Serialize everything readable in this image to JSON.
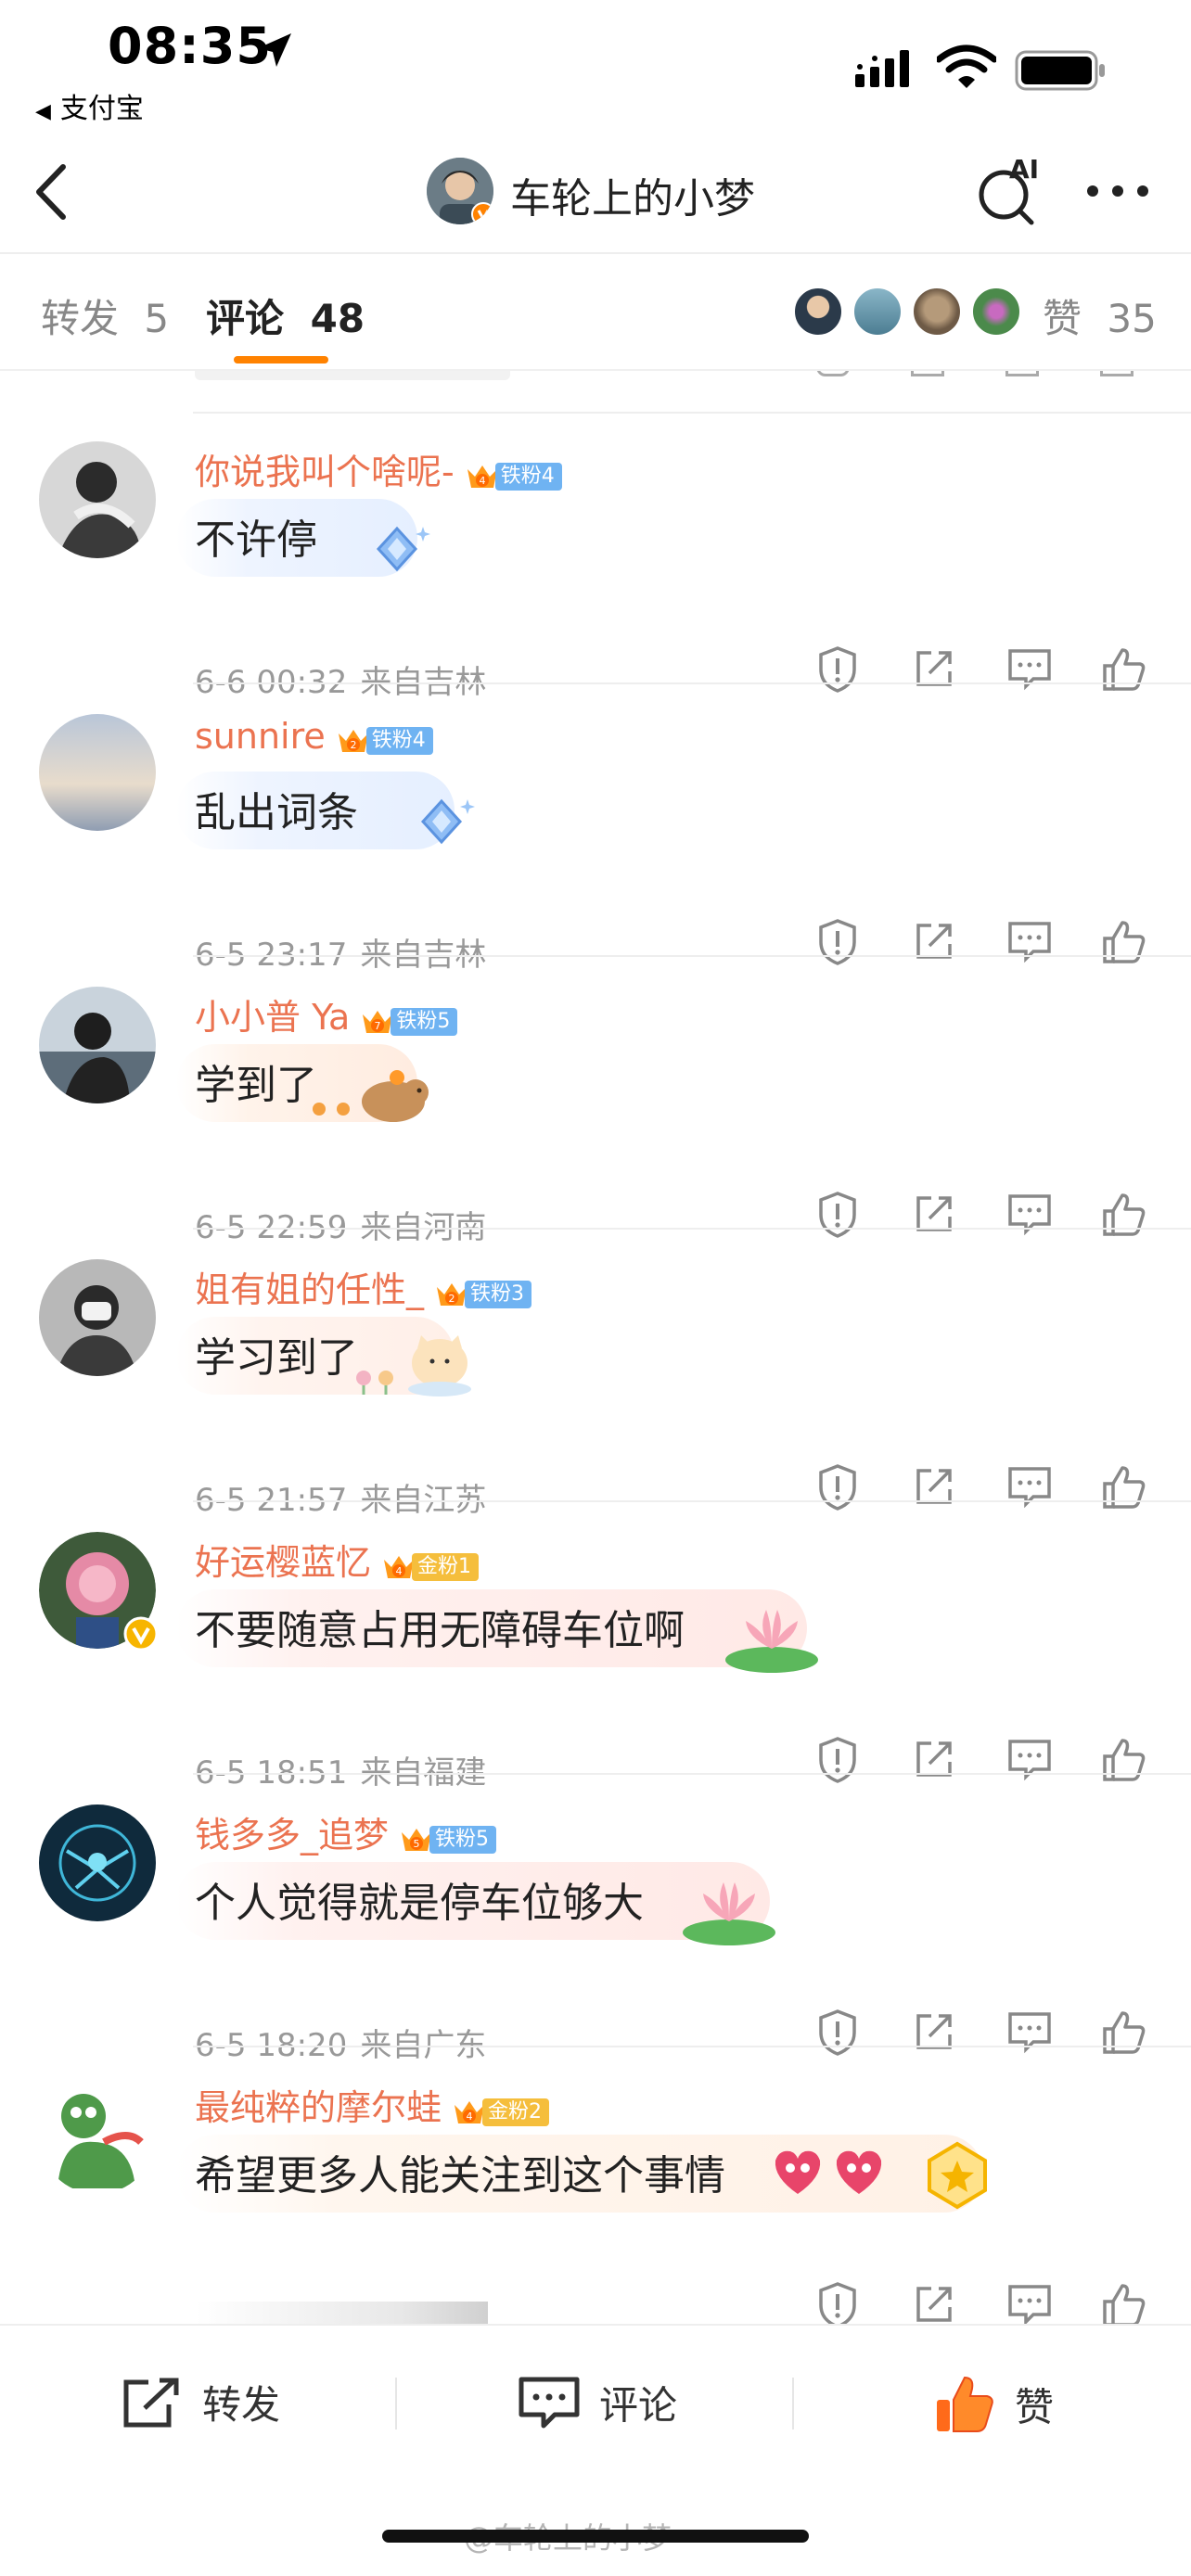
{
  "status_bar": {
    "time": "08:35",
    "back_app": "支付宝"
  },
  "nav": {
    "title": "车轮上的小梦",
    "ai_label": "AI"
  },
  "tabs": {
    "repost_label": "转发",
    "repost_count": "5",
    "comment_label": "评论",
    "comment_count": "48",
    "likes_label": "赞",
    "likes_count": "35"
  },
  "comments": [
    {
      "username": "你说我叫个啥呢-",
      "badge_level": "4",
      "badge_label": "铁粉4",
      "badge_type": "iron",
      "text": "不许停",
      "date": "6-6 00:32",
      "location": "来自吉林"
    },
    {
      "username": "sunnire",
      "badge_level": "2",
      "badge_label": "铁粉4",
      "badge_type": "iron",
      "text": "乱出词条",
      "date": "6-5 23:17",
      "location": "来自吉林"
    },
    {
      "username": "小小普 Ya",
      "badge_level": "7",
      "badge_label": "铁粉5",
      "badge_type": "iron",
      "text": "学到了",
      "date": "6-5 22:59",
      "location": "来自河南"
    },
    {
      "username": "姐有姐的任性_",
      "badge_level": "2",
      "badge_label": "铁粉3",
      "badge_type": "iron",
      "text": "学习到了",
      "date": "6-5 21:57",
      "location": "来自江苏"
    },
    {
      "username": "好运樱蓝忆",
      "badge_level": "4",
      "badge_label": "金粉1",
      "badge_type": "gold",
      "text": "不要随意占用无障碍车位啊",
      "date": "6-5 18:51",
      "location": "来自福建"
    },
    {
      "username": "钱多多_追梦",
      "badge_level": "5",
      "badge_label": "铁粉5",
      "badge_type": "iron",
      "text": "个人觉得就是停车位够大",
      "date": "6-5 18:20",
      "location": "来自广东"
    },
    {
      "username": "最纯粹的摩尔蛙",
      "badge_level": "4",
      "badge_label": "金粉2",
      "badge_type": "gold",
      "text": "希望更多人能关注到这个事情",
      "date": "",
      "location": ""
    }
  ],
  "bottom_bar": {
    "repost": "转发",
    "comment": "评论",
    "like": "赞"
  },
  "watermark": "@车轮上的小梦",
  "colors": {
    "accent": "#ff8200",
    "username": "#eb7350",
    "iron_badge": "#6fb3f2",
    "gold_badge": "#f5be3c",
    "meta": "#999999"
  }
}
